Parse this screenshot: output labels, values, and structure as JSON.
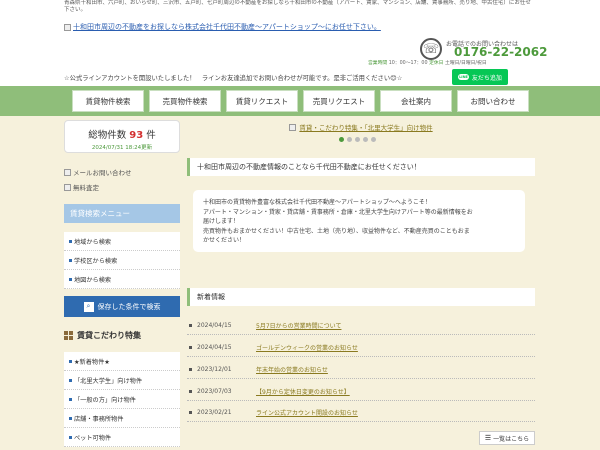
{
  "header": {
    "meta_text": "青森県十和田市、六戸町、おいらせ町、三沢市、五戸町、七戸町周辺の不動産をお探しなら十和田市の不動産（アパート、賃家、マンション、店舗、賃事務所、売り地、中古住宅）にお任せ下さい。",
    "logo_alt": "十和田市周辺の不動産をお探しなら株式会社千代田不動産～アパートショップ～にお任せ下さい。",
    "phone_lead": "お電話でのお問い合わせは",
    "phone_number": "0176-22-2062",
    "hours_label": "営業時間",
    "hours": "10：00～17：00",
    "holiday_label": "定休日",
    "holidays": "土曜日/日曜日/祝日",
    "line_message": "☆公式ラインアカウントを開設いたしました！　ラインお友達追加でお問い合わせが可能です。是非ご活用ください😊☆",
    "line_badge": "LINE",
    "line_button": "友だち追加"
  },
  "nav": {
    "items": [
      "賃貸物件検索",
      "売買物件検索",
      "賃貸リクエスト",
      "売買リクエスト",
      "会社案内",
      "お問い合わせ"
    ]
  },
  "sidebar": {
    "count_label": "総物件数",
    "count": "93",
    "count_unit": "件",
    "updated": "2024/07/31 18:24更新",
    "mail_link": "メールお問い合わせ",
    "estimate_link": "無料査定",
    "search_head": "賃貸検索メニュー",
    "search_items": [
      "地域から検索",
      "学校区から検索",
      "地図から検索"
    ],
    "save_button": "保存した条件で検索",
    "special_head": "賃貸こだわり特集",
    "special_items": [
      "★新着物件★",
      "「北里大学生」向け物件",
      "「一般の方」向け物件",
      "店舗・事務所物件",
      "ペット可物件"
    ]
  },
  "main": {
    "banner": "賃貸・こだわり特集・「北里大学生」向け物件",
    "welcome_title": "十和田市周辺の不動産情報のことなら千代田不動産にお任せください！",
    "welcome_lines": [
      "十和田市の賃貸物件豊富な株式会社千代田不動産～アパートショップ～へようこそ！",
      "アパート・マンション・貸家・貸店舗・賃事務所・倉庫・北里大学生向けアパート等の最新情報をお",
      "届けします！",
      "売買物件もおまかせください！中古住宅、土地（売り地）、収益物件など、不動産売買のこともおま",
      "かせください！"
    ],
    "news_title": "新着情報",
    "news": [
      {
        "date": "2024/04/15",
        "title": "5月7日からの営業時間について"
      },
      {
        "date": "2024/04/15",
        "title": "ゴールデンウィークの営業のお知らせ"
      },
      {
        "date": "2023/12/01",
        "title": "年末年始の営業のお知らせ"
      },
      {
        "date": "2023/07/03",
        "title": "【9月から定休日変更のお知らせ】"
      },
      {
        "date": "2023/02/21",
        "title": "ライン公式アカウント開設のお知らせ"
      }
    ],
    "more_button": "一覧はこちら"
  },
  "colors": {
    "accent_green": "#8fbe7a",
    "phone_green": "#4d9a3c",
    "count_red": "#d32f2f",
    "save_blue": "#2f6bb0",
    "line_green": "#06c755"
  }
}
